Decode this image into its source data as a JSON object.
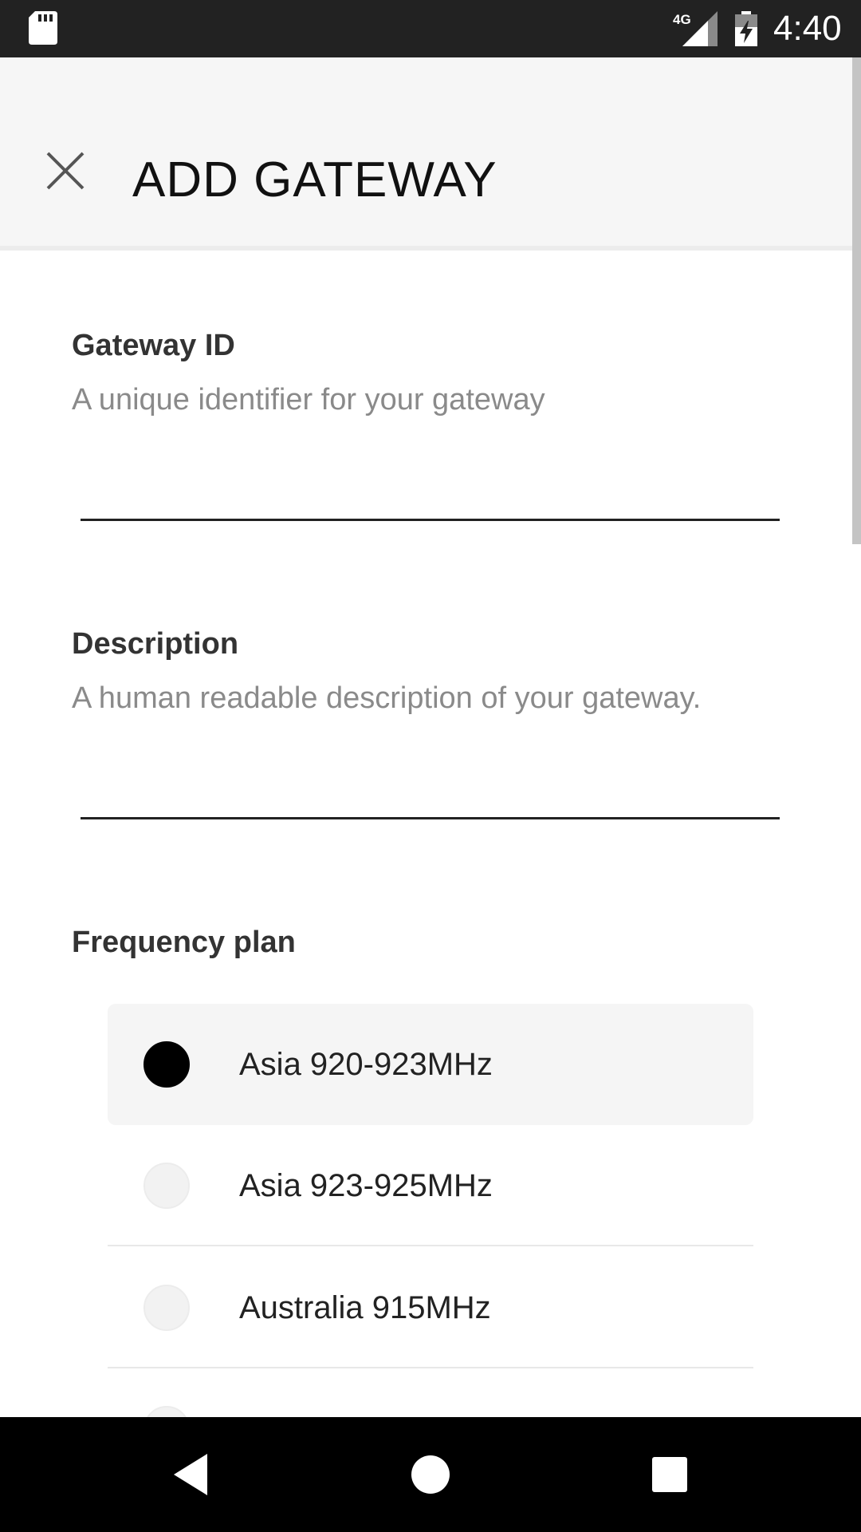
{
  "status_bar": {
    "time": "4:40",
    "network": "4G",
    "icons": [
      "sd-card-icon",
      "signal-4g-icon",
      "battery-charging-icon"
    ]
  },
  "toolbar": {
    "title": "ADD GATEWAY",
    "close_icon": "close-icon"
  },
  "form": {
    "gateway_id": {
      "label": "Gateway ID",
      "description": "A unique identifier for your gateway",
      "value": ""
    },
    "description": {
      "label": "Description",
      "description": "A human readable description of your gateway.",
      "value": ""
    },
    "frequency_plan": {
      "label": "Frequency plan",
      "options": [
        {
          "label": "Asia 920-923MHz",
          "selected": true
        },
        {
          "label": "Asia 923-925MHz",
          "selected": false
        },
        {
          "label": "Australia 915MHz",
          "selected": false
        }
      ]
    }
  },
  "nav_bar": {
    "icons": [
      "back-icon",
      "home-icon",
      "recents-icon"
    ]
  },
  "colors": {
    "status_bar": "#222222",
    "toolbar": "#f6f6f6",
    "selected_option_bg": "#f5f5f5",
    "nav_bar": "#000000"
  }
}
